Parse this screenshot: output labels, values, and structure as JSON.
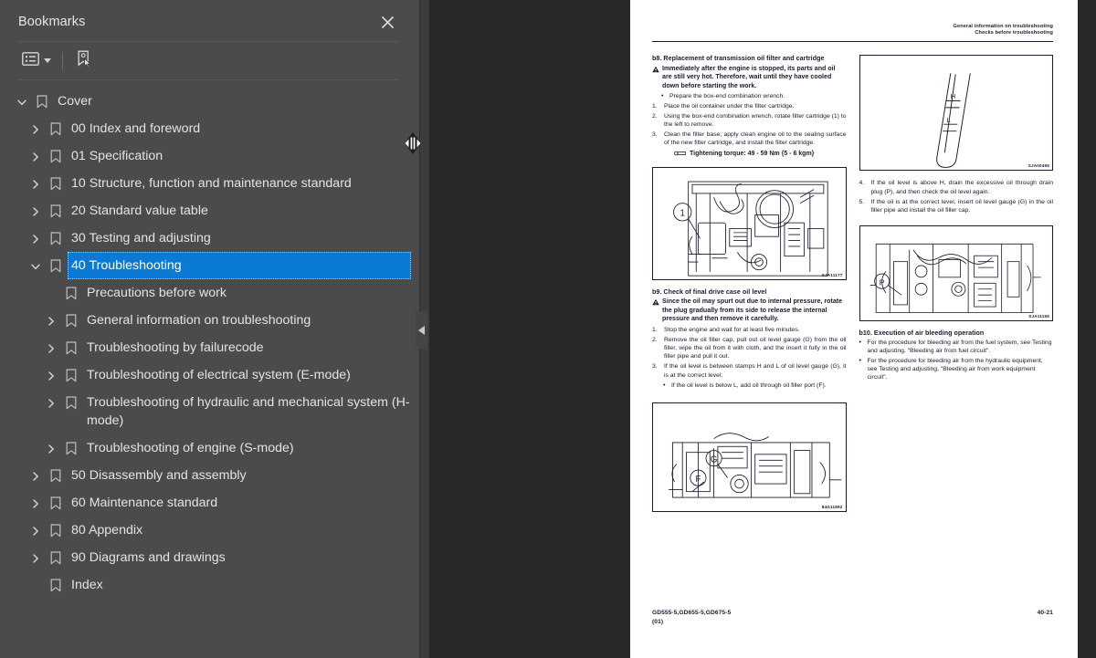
{
  "sidebar": {
    "title": "Bookmarks",
    "close_icon": "close-icon",
    "toolbar": {
      "options_label": "list-options-icon",
      "caret_label": "chevron-down-icon",
      "new_bookmark_label": "new-bookmark-icon"
    },
    "tree": [
      {
        "level": 0,
        "twisty": "down",
        "label": "Cover",
        "selected": false
      },
      {
        "level": 1,
        "twisty": "right",
        "label": "00 Index and foreword",
        "selected": false
      },
      {
        "level": 1,
        "twisty": "right",
        "label": "01 Specification",
        "selected": false
      },
      {
        "level": 1,
        "twisty": "right",
        "label": "10 Structure, function and maintenance standard",
        "selected": false
      },
      {
        "level": 1,
        "twisty": "right",
        "label": "20 Standard value table",
        "selected": false
      },
      {
        "level": 1,
        "twisty": "right",
        "label": "30 Testing and adjusting",
        "selected": false
      },
      {
        "level": 1,
        "twisty": "down",
        "label": "40 Troubleshooting",
        "selected": true
      },
      {
        "level": 2,
        "twisty": "none",
        "label": "Precautions before work",
        "selected": false
      },
      {
        "level": 2,
        "twisty": "right",
        "label": "General information on troubleshooting",
        "selected": false
      },
      {
        "level": 2,
        "twisty": "right",
        "label": "Troubleshooting by failurecode",
        "selected": false
      },
      {
        "level": 2,
        "twisty": "right",
        "label": "Troubleshooting of electrical system (E-mode)",
        "selected": false
      },
      {
        "level": 2,
        "twisty": "right",
        "label": "Troubleshooting of hydraulic and mechanical system (H-mode)",
        "selected": false
      },
      {
        "level": 2,
        "twisty": "right",
        "label": "Troubleshooting of engine (S-mode)",
        "selected": false
      },
      {
        "level": 1,
        "twisty": "right",
        "label": "50 Disassembly and assembly",
        "selected": false
      },
      {
        "level": 1,
        "twisty": "right",
        "label": "60 Maintenance standard",
        "selected": false
      },
      {
        "level": 1,
        "twisty": "right",
        "label": "80 Appendix",
        "selected": false
      },
      {
        "level": 1,
        "twisty": "right",
        "label": "90 Diagrams and drawings",
        "selected": false
      },
      {
        "level": 1,
        "twisty": "none",
        "label": "Index",
        "selected": false
      }
    ],
    "collapse_handle_icon": "collapse-left-arrow-icon",
    "resize_cursor_icon": "horizontal-resize-cursor"
  },
  "page": {
    "header_line1": "General information on troubleshooting",
    "header_line2": "Checks before troubleshooting",
    "left_column": {
      "b8_heading": "b8. Replacement of transmission oil filter and cartridge",
      "b8_warning": "Immediately after the engine is stopped, its parts and oil are still very hot. Therefore, wait until they have cooled down before starting the work.",
      "b8_bullet1": "Prepare the box-end combination wrench.",
      "b8_step1_num": "1.",
      "b8_step1": "Place the oil container under the filter cartridge.",
      "b8_step2_num": "2.",
      "b8_step2": "Using the box-end combination wrench, rotate filter cartridge (1) to the left to remove.",
      "b8_step3_num": "3.",
      "b8_step3": "Clean the filter base, apply clean engine oil to the sealing surface of the new filter cartridge, and install the filter cartridge.",
      "b8_torque": "Tightening torque:  49 - 59 Nm {5 - 6 kgm}",
      "fig_sja11177_code": "SJA11177",
      "fig_sja11177_callout": "1",
      "b9_heading": "b9. Check of final drive case oil level",
      "b9_warning": "Since the oil may spurt out due to internal pressure, rotate the plug gradually from its side to release the internal pressure and then remove it carefully.",
      "b9_step1_num": "1.",
      "b9_step1": "Stop the engine and wait for at least five minutes.",
      "b9_step2_num": "2.",
      "b9_step2": "Remove the oil filler cap, pull out oil level gauge (G) from the oil filler, wipe the oil from it with cloth, and the insert it fully in the oil filler pipe and pull it out.",
      "b9_step3_num": "3.",
      "b9_step3": "If the oil level is between stamps H and L of oil level gauge (G), it is at the correct level.",
      "b9_bullet1": "If the oil level is below L, add oil through oil filler port (F).",
      "fig_84g11892_code": "84G11892",
      "fig_84g11892_callout_g": "G",
      "fig_84g11892_callout_f": "F"
    },
    "right_column": {
      "fig_sja00495_code": "SJA00495",
      "fig_sja00495_mark_h": "H",
      "fig_sja00495_mark_l": "L",
      "step4_num": "4.",
      "step4": "If the oil level is above H, drain the excessive oil through drain plug (P), and then check the oil level again.",
      "step5_num": "5.",
      "step5": "If the oil is at the correct level, insert oil level gauge (G) in the oil filler pipe and install the oil filler cap.",
      "fig_sja11166_code": "SJA11166",
      "fig_sja11166_callout": "P",
      "b10_heading": "b10. Execution of air bleeding operation",
      "b10_bullet1": "For the procedure for bleeding air from the fuel system, see Testing and adjusting, \"Bleeding air from fuel circuit\".",
      "b10_bullet2": "For the procedure for bleeding air from the hydraulic equipment, see Testing and adjusting, \"Bleeding air from work equipment circuit\"."
    },
    "footer_left_line1": "GD555-5,GD655-5,GD675-5",
    "footer_left_line2": "(01)",
    "footer_right": "40-21"
  },
  "colors": {
    "panel_bg": "#4b4b4b",
    "app_bg": "#3c3c3c",
    "viewer_bg": "#282828",
    "selection": "#0b7ad4",
    "text": "#e3e3e3",
    "page_bg": "#ffffff",
    "page_ink": "#1a1a2e"
  }
}
